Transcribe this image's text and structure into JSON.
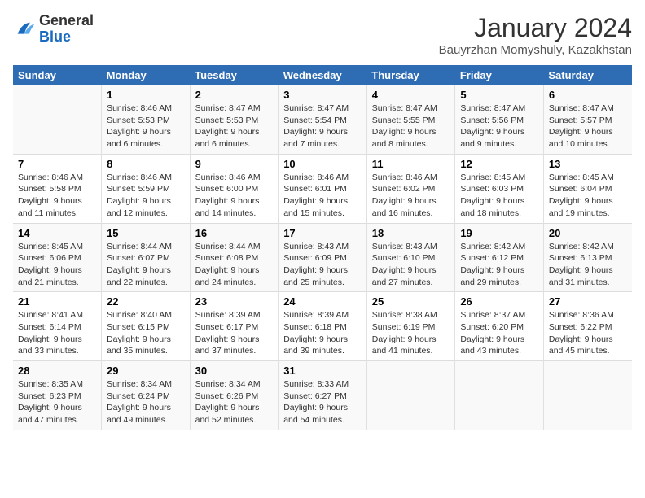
{
  "logo": {
    "general": "General",
    "blue": "Blue"
  },
  "title": "January 2024",
  "subtitle": "Bauyrzhan Momyshuly, Kazakhstan",
  "days_of_week": [
    "Sunday",
    "Monday",
    "Tuesday",
    "Wednesday",
    "Thursday",
    "Friday",
    "Saturday"
  ],
  "weeks": [
    [
      {
        "day": "",
        "sunrise": "",
        "sunset": "",
        "daylight": ""
      },
      {
        "day": "1",
        "sunrise": "Sunrise: 8:46 AM",
        "sunset": "Sunset: 5:53 PM",
        "daylight": "Daylight: 9 hours and 6 minutes."
      },
      {
        "day": "2",
        "sunrise": "Sunrise: 8:47 AM",
        "sunset": "Sunset: 5:53 PM",
        "daylight": "Daylight: 9 hours and 6 minutes."
      },
      {
        "day": "3",
        "sunrise": "Sunrise: 8:47 AM",
        "sunset": "Sunset: 5:54 PM",
        "daylight": "Daylight: 9 hours and 7 minutes."
      },
      {
        "day": "4",
        "sunrise": "Sunrise: 8:47 AM",
        "sunset": "Sunset: 5:55 PM",
        "daylight": "Daylight: 9 hours and 8 minutes."
      },
      {
        "day": "5",
        "sunrise": "Sunrise: 8:47 AM",
        "sunset": "Sunset: 5:56 PM",
        "daylight": "Daylight: 9 hours and 9 minutes."
      },
      {
        "day": "6",
        "sunrise": "Sunrise: 8:47 AM",
        "sunset": "Sunset: 5:57 PM",
        "daylight": "Daylight: 9 hours and 10 minutes."
      }
    ],
    [
      {
        "day": "7",
        "sunrise": "Sunrise: 8:46 AM",
        "sunset": "Sunset: 5:58 PM",
        "daylight": "Daylight: 9 hours and 11 minutes."
      },
      {
        "day": "8",
        "sunrise": "Sunrise: 8:46 AM",
        "sunset": "Sunset: 5:59 PM",
        "daylight": "Daylight: 9 hours and 12 minutes."
      },
      {
        "day": "9",
        "sunrise": "Sunrise: 8:46 AM",
        "sunset": "Sunset: 6:00 PM",
        "daylight": "Daylight: 9 hours and 14 minutes."
      },
      {
        "day": "10",
        "sunrise": "Sunrise: 8:46 AM",
        "sunset": "Sunset: 6:01 PM",
        "daylight": "Daylight: 9 hours and 15 minutes."
      },
      {
        "day": "11",
        "sunrise": "Sunrise: 8:46 AM",
        "sunset": "Sunset: 6:02 PM",
        "daylight": "Daylight: 9 hours and 16 minutes."
      },
      {
        "day": "12",
        "sunrise": "Sunrise: 8:45 AM",
        "sunset": "Sunset: 6:03 PM",
        "daylight": "Daylight: 9 hours and 18 minutes."
      },
      {
        "day": "13",
        "sunrise": "Sunrise: 8:45 AM",
        "sunset": "Sunset: 6:04 PM",
        "daylight": "Daylight: 9 hours and 19 minutes."
      }
    ],
    [
      {
        "day": "14",
        "sunrise": "Sunrise: 8:45 AM",
        "sunset": "Sunset: 6:06 PM",
        "daylight": "Daylight: 9 hours and 21 minutes."
      },
      {
        "day": "15",
        "sunrise": "Sunrise: 8:44 AM",
        "sunset": "Sunset: 6:07 PM",
        "daylight": "Daylight: 9 hours and 22 minutes."
      },
      {
        "day": "16",
        "sunrise": "Sunrise: 8:44 AM",
        "sunset": "Sunset: 6:08 PM",
        "daylight": "Daylight: 9 hours and 24 minutes."
      },
      {
        "day": "17",
        "sunrise": "Sunrise: 8:43 AM",
        "sunset": "Sunset: 6:09 PM",
        "daylight": "Daylight: 9 hours and 25 minutes."
      },
      {
        "day": "18",
        "sunrise": "Sunrise: 8:43 AM",
        "sunset": "Sunset: 6:10 PM",
        "daylight": "Daylight: 9 hours and 27 minutes."
      },
      {
        "day": "19",
        "sunrise": "Sunrise: 8:42 AM",
        "sunset": "Sunset: 6:12 PM",
        "daylight": "Daylight: 9 hours and 29 minutes."
      },
      {
        "day": "20",
        "sunrise": "Sunrise: 8:42 AM",
        "sunset": "Sunset: 6:13 PM",
        "daylight": "Daylight: 9 hours and 31 minutes."
      }
    ],
    [
      {
        "day": "21",
        "sunrise": "Sunrise: 8:41 AM",
        "sunset": "Sunset: 6:14 PM",
        "daylight": "Daylight: 9 hours and 33 minutes."
      },
      {
        "day": "22",
        "sunrise": "Sunrise: 8:40 AM",
        "sunset": "Sunset: 6:15 PM",
        "daylight": "Daylight: 9 hours and 35 minutes."
      },
      {
        "day": "23",
        "sunrise": "Sunrise: 8:39 AM",
        "sunset": "Sunset: 6:17 PM",
        "daylight": "Daylight: 9 hours and 37 minutes."
      },
      {
        "day": "24",
        "sunrise": "Sunrise: 8:39 AM",
        "sunset": "Sunset: 6:18 PM",
        "daylight": "Daylight: 9 hours and 39 minutes."
      },
      {
        "day": "25",
        "sunrise": "Sunrise: 8:38 AM",
        "sunset": "Sunset: 6:19 PM",
        "daylight": "Daylight: 9 hours and 41 minutes."
      },
      {
        "day": "26",
        "sunrise": "Sunrise: 8:37 AM",
        "sunset": "Sunset: 6:20 PM",
        "daylight": "Daylight: 9 hours and 43 minutes."
      },
      {
        "day": "27",
        "sunrise": "Sunrise: 8:36 AM",
        "sunset": "Sunset: 6:22 PM",
        "daylight": "Daylight: 9 hours and 45 minutes."
      }
    ],
    [
      {
        "day": "28",
        "sunrise": "Sunrise: 8:35 AM",
        "sunset": "Sunset: 6:23 PM",
        "daylight": "Daylight: 9 hours and 47 minutes."
      },
      {
        "day": "29",
        "sunrise": "Sunrise: 8:34 AM",
        "sunset": "Sunset: 6:24 PM",
        "daylight": "Daylight: 9 hours and 49 minutes."
      },
      {
        "day": "30",
        "sunrise": "Sunrise: 8:34 AM",
        "sunset": "Sunset: 6:26 PM",
        "daylight": "Daylight: 9 hours and 52 minutes."
      },
      {
        "day": "31",
        "sunrise": "Sunrise: 8:33 AM",
        "sunset": "Sunset: 6:27 PM",
        "daylight": "Daylight: 9 hours and 54 minutes."
      },
      {
        "day": "",
        "sunrise": "",
        "sunset": "",
        "daylight": ""
      },
      {
        "day": "",
        "sunrise": "",
        "sunset": "",
        "daylight": ""
      },
      {
        "day": "",
        "sunrise": "",
        "sunset": "",
        "daylight": ""
      }
    ]
  ]
}
